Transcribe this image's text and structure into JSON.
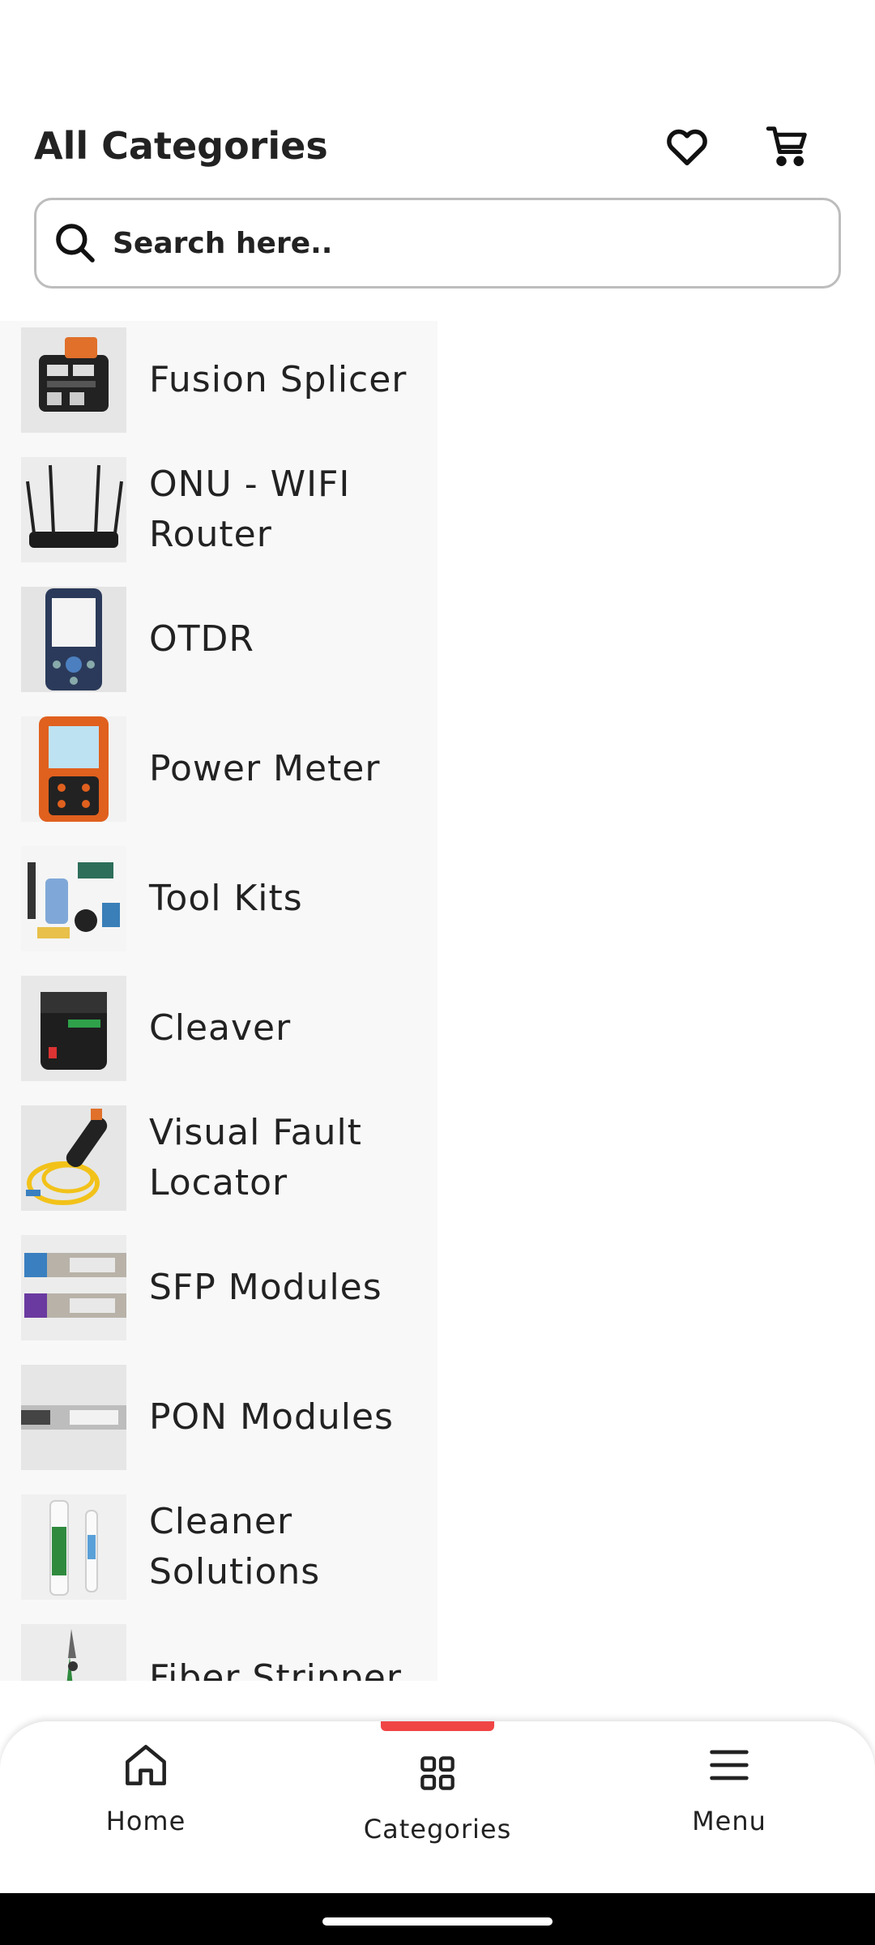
{
  "header": {
    "title": "All Categories",
    "wishlist_icon": "heart-icon",
    "cart_icon": "cart-icon"
  },
  "search": {
    "placeholder": "Search here..",
    "value": "",
    "icon": "search-icon"
  },
  "categories": [
    {
      "label": "Fusion Splicer",
      "icon": "fusion-splicer-thumbnail"
    },
    {
      "label": "ONU - WIFI Router",
      "icon": "router-thumbnail"
    },
    {
      "label": "OTDR",
      "icon": "otdr-thumbnail"
    },
    {
      "label": "Power Meter",
      "icon": "power-meter-thumbnail"
    },
    {
      "label": "Tool Kits",
      "icon": "tool-kit-thumbnail"
    },
    {
      "label": "Cleaver",
      "icon": "cleaver-thumbnail"
    },
    {
      "label": "Visual Fault Locator",
      "icon": "vfl-thumbnail"
    },
    {
      "label": "SFP Modules",
      "icon": "sfp-thumbnail"
    },
    {
      "label": "PON Modules",
      "icon": "pon-thumbnail"
    },
    {
      "label": "Cleaner Solutions",
      "icon": "cleaner-thumbnail"
    },
    {
      "label": "Fiber Stripper",
      "icon": "stripper-thumbnail"
    }
  ],
  "bottom_nav": {
    "items": [
      {
        "label": "Home",
        "icon": "home-icon"
      },
      {
        "label": "Categories",
        "icon": "grid-icon",
        "active": true
      },
      {
        "label": "Menu",
        "icon": "menu-icon"
      }
    ],
    "active_color": "#f04545"
  }
}
